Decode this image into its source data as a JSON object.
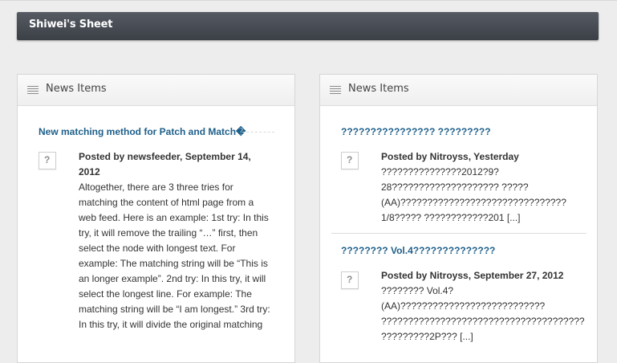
{
  "site": {
    "title": "Shiwei's Sheet"
  },
  "panels": [
    {
      "title": "News Items",
      "items": [
        {
          "title": "New matching method for Patch and Match�",
          "byline": "Posted by newsfeeder, September 14,\n2012",
          "body": "Altogether, there are 3 three tries for\nmatching the content of html page from a\nweb feed. Here is an example: 1st try: In this\ntry, it will remove the trailing “…” first, then\nselect the node with longest text. For\nexample: The matching string will be “This is\nan longer example”. 2nd try: In this try, it will\nselect the longest line. For example: The\nmatching string will be “I am longest.” 3rd try:\nIn this try, it will divide the original matching"
        }
      ]
    },
    {
      "title": "News Items",
      "items": [
        {
          "title": "???????????????? ?????????",
          "byline": "Posted by Nitroyss, Yesterday",
          "body": "???????????????2012?9?\n28???????????????????? ?????\n(AA)???????????????????????????????\n1/8????? ????????????201 [...]"
        },
        {
          "title": "???????? Vol.4??????????????",
          "byline": "Posted by Nitroyss, September 27, 2012",
          "body": "???????? Vol.4?\n(AA)???????????????????????????\n??????????????????????????????????????\n?????????2P??? [...]"
        }
      ]
    }
  ],
  "icons": {
    "avatar_placeholder": "?"
  }
}
